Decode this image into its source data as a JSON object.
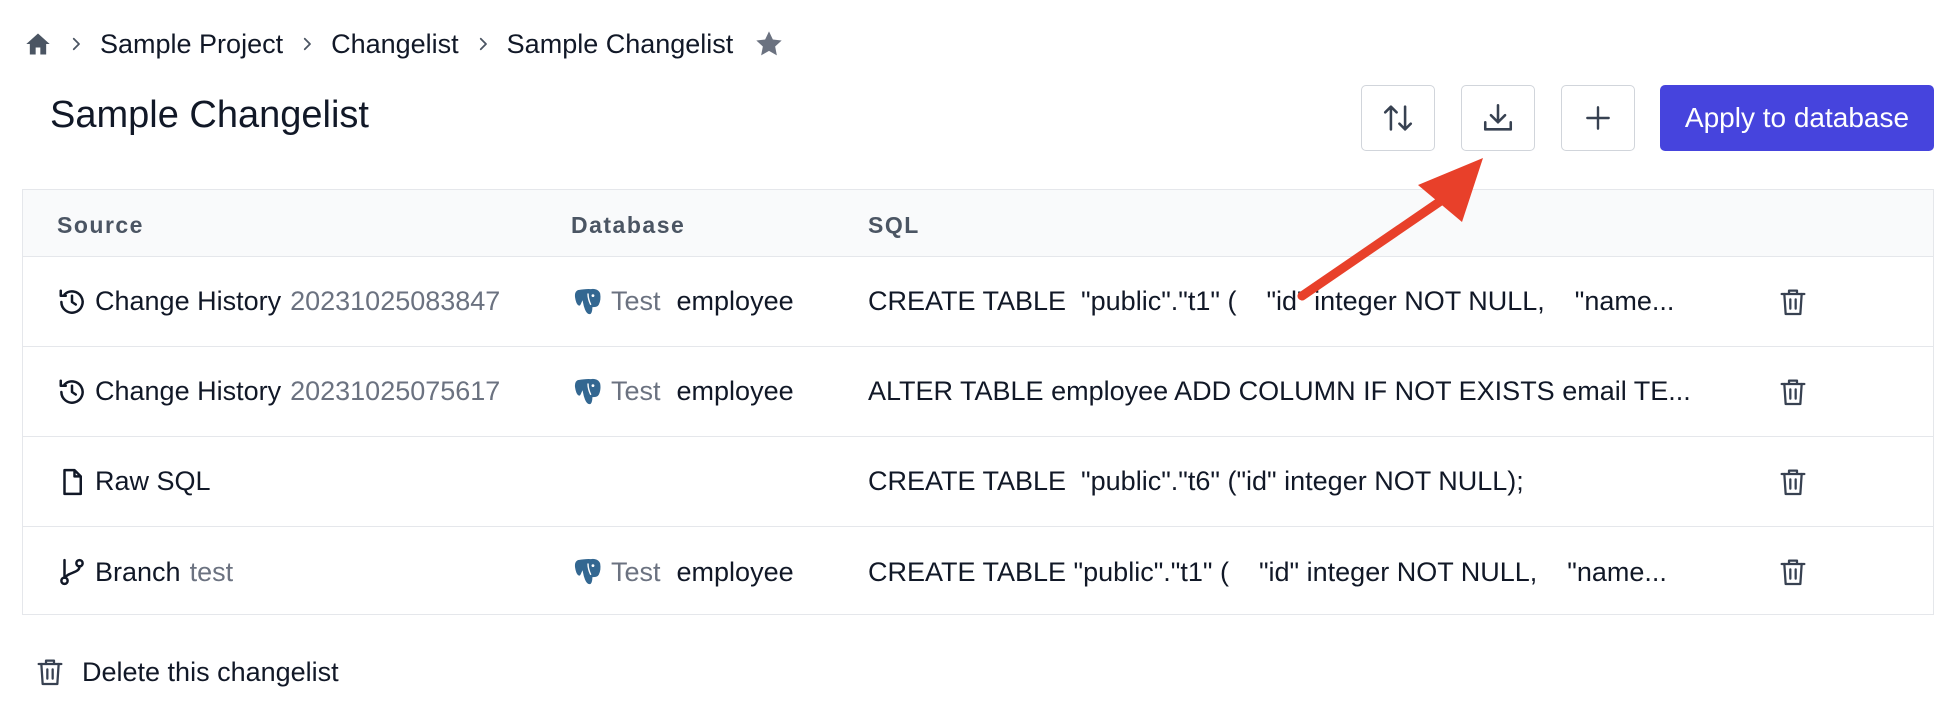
{
  "breadcrumb": {
    "items": [
      "Sample Project",
      "Changelist",
      "Sample Changelist"
    ]
  },
  "page": {
    "title": "Sample Changelist"
  },
  "toolbar": {
    "apply_label": "Apply to database",
    "apply_color": "#4644dd"
  },
  "table": {
    "headers": [
      "Source",
      "Database",
      "SQL"
    ],
    "rows": [
      {
        "source_type": "Change History",
        "source_detail": "20231025083847",
        "source_icon": "history-icon",
        "db_env": "Test",
        "db_name": "employee",
        "sql": "CREATE TABLE  \"public\".\"t1\" (    \"id\" integer NOT NULL,    \"name..."
      },
      {
        "source_type": "Change History",
        "source_detail": "20231025075617",
        "source_icon": "history-icon",
        "db_env": "Test",
        "db_name": "employee",
        "sql": "ALTER TABLE employee ADD COLUMN IF NOT EXISTS email TE..."
      },
      {
        "source_type": "Raw SQL",
        "source_detail": "",
        "source_icon": "file-icon",
        "db_env": "",
        "db_name": "",
        "sql": "CREATE TABLE  \"public\".\"t6\" (\"id\" integer NOT NULL);"
      },
      {
        "source_type": "Branch",
        "source_detail": "test",
        "source_icon": "branch-icon",
        "db_env": "Test",
        "db_name": "employee",
        "sql": "CREATE TABLE \"public\".\"t1\" (    \"id\" integer NOT NULL,    \"name..."
      }
    ]
  },
  "footer": {
    "delete_label": "Delete this changelist"
  },
  "annotation": {
    "arrow_color": "#e8402a"
  }
}
